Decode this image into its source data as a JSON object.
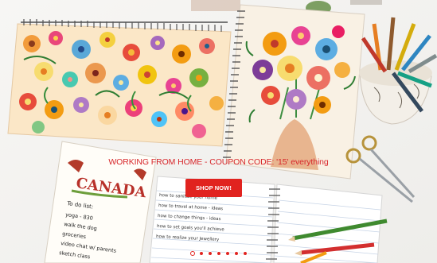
{
  "banner": {
    "headline": "WORKING FROM HOME - COUPON CODE: '15' everything",
    "button_label": "SHOP NOW!",
    "slide_count": 7,
    "active_slide": 1,
    "colors": {
      "accent": "#e1231f",
      "headline": "#d7262a"
    }
  },
  "photo": {
    "postcard_title": "CANADA",
    "postcard_list_heading": "To do list:",
    "postcard_items": [
      "yoga - 830",
      "walk the dog",
      "groceries",
      "video chat w/ parents",
      "sketch class"
    ],
    "notebook_lines": [
      "how to sanitize your home",
      "how to travel at home - ideas",
      "how to change things - ideas",
      "how to set goals you'll achieve",
      "how to realize your Jewellery"
    ]
  }
}
